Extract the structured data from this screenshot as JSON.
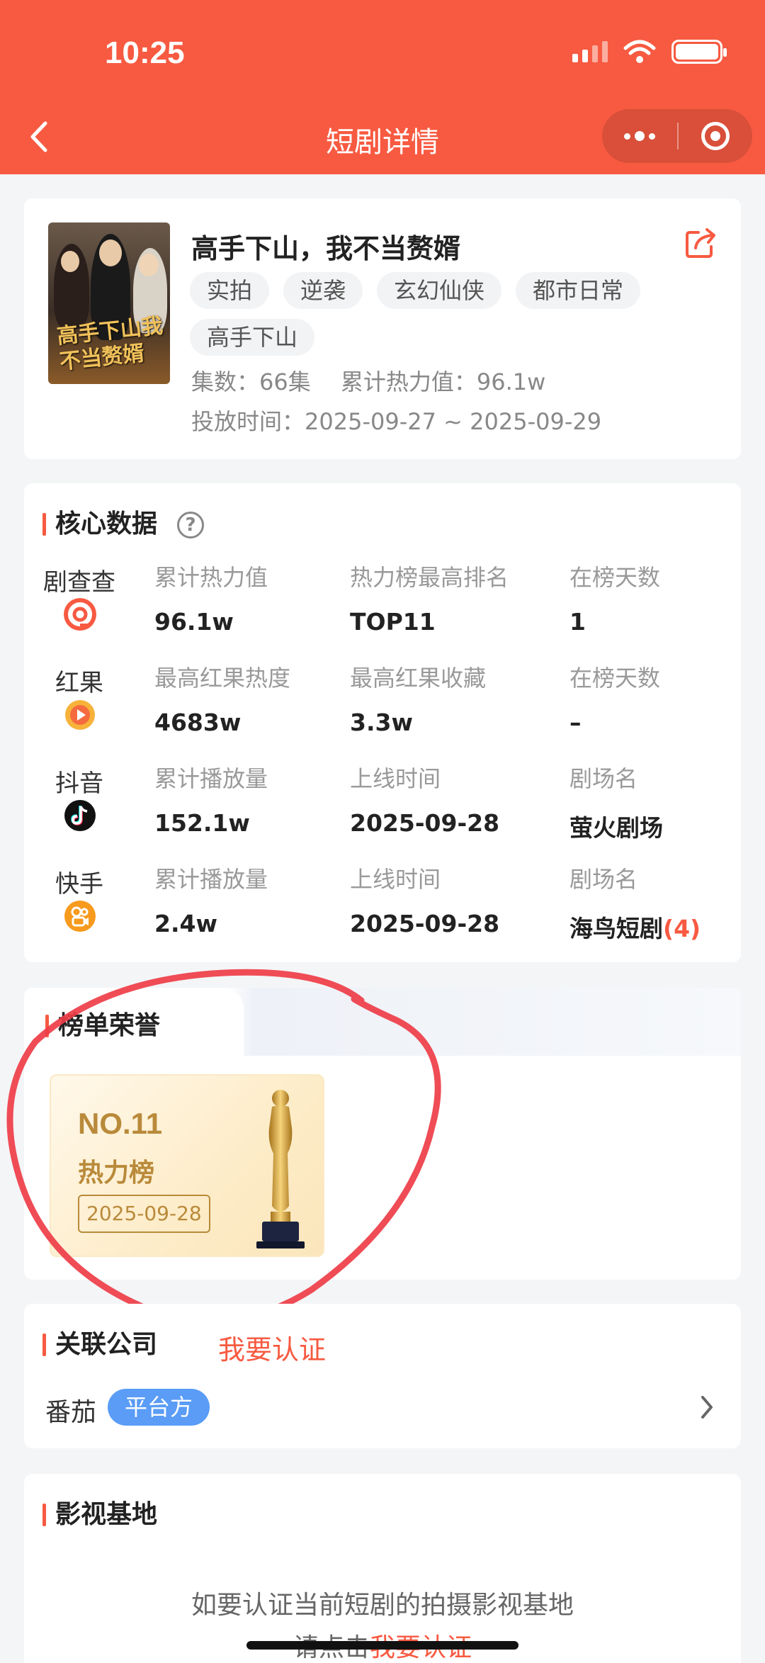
{
  "status_bar": {
    "time": "10:25"
  },
  "nav": {
    "title": "短剧详情"
  },
  "drama": {
    "title": "高手下山，我不当赘婿",
    "poster_text": "高手下山我不当赘婿",
    "tags": [
      "实拍",
      "逆袭",
      "玄幻仙侠",
      "都市日常",
      "高手下山"
    ],
    "episodes_line": "集数：66集　 累计热力值：96.1w",
    "release_line": "投放时间：2025-09-27 ~ 2025-09-29"
  },
  "core_data": {
    "title": "核心数据",
    "help_glyph": "?",
    "rows": [
      {
        "platform": "剧查查",
        "icon": "juchacha-icon",
        "icon_color": "#f75a41",
        "labels": [
          "累计热力值",
          "热力榜最高排名",
          "在榜天数"
        ],
        "values": [
          "96.1w",
          "TOP11",
          "1"
        ]
      },
      {
        "platform": "红果",
        "icon": "hongguo-icon",
        "icon_color": "#f5a623",
        "labels": [
          "最高红果热度",
          "最高红果收藏",
          "在榜天数"
        ],
        "values": [
          "4683w",
          "3.3w",
          "–"
        ]
      },
      {
        "platform": "抖音",
        "icon": "douyin-icon",
        "icon_color": "#111111",
        "labels": [
          "累计播放量",
          "上线时间",
          "剧场名"
        ],
        "values": [
          "152.1w",
          "2025-09-28",
          "萤火剧场"
        ]
      },
      {
        "platform": "快手",
        "icon": "kuaishou-icon",
        "icon_color": "#f79a1e",
        "labels": [
          "累计播放量",
          "上线时间",
          "剧场名"
        ],
        "values": [
          "2.4w",
          "2025-09-28",
          "海鸟短剧"
        ],
        "extra": "(4)"
      }
    ]
  },
  "honor": {
    "title": "榜单荣誉",
    "award": {
      "rank": "NO.11",
      "list_name": "热力榜",
      "date": "2025-09-28"
    }
  },
  "company": {
    "title": "关联公司",
    "verify_label": "我要认证",
    "name": "番茄",
    "badge": "平台方"
  },
  "studio": {
    "title": "影视基地",
    "line1": "如要认证当前短剧的拍摄影视基地",
    "line2_prefix": "请点击",
    "line2_link": "我要认证"
  },
  "colors": {
    "primary": "#f75a41",
    "badge_blue": "#5a9cf6",
    "gold": "#b98a3a"
  }
}
